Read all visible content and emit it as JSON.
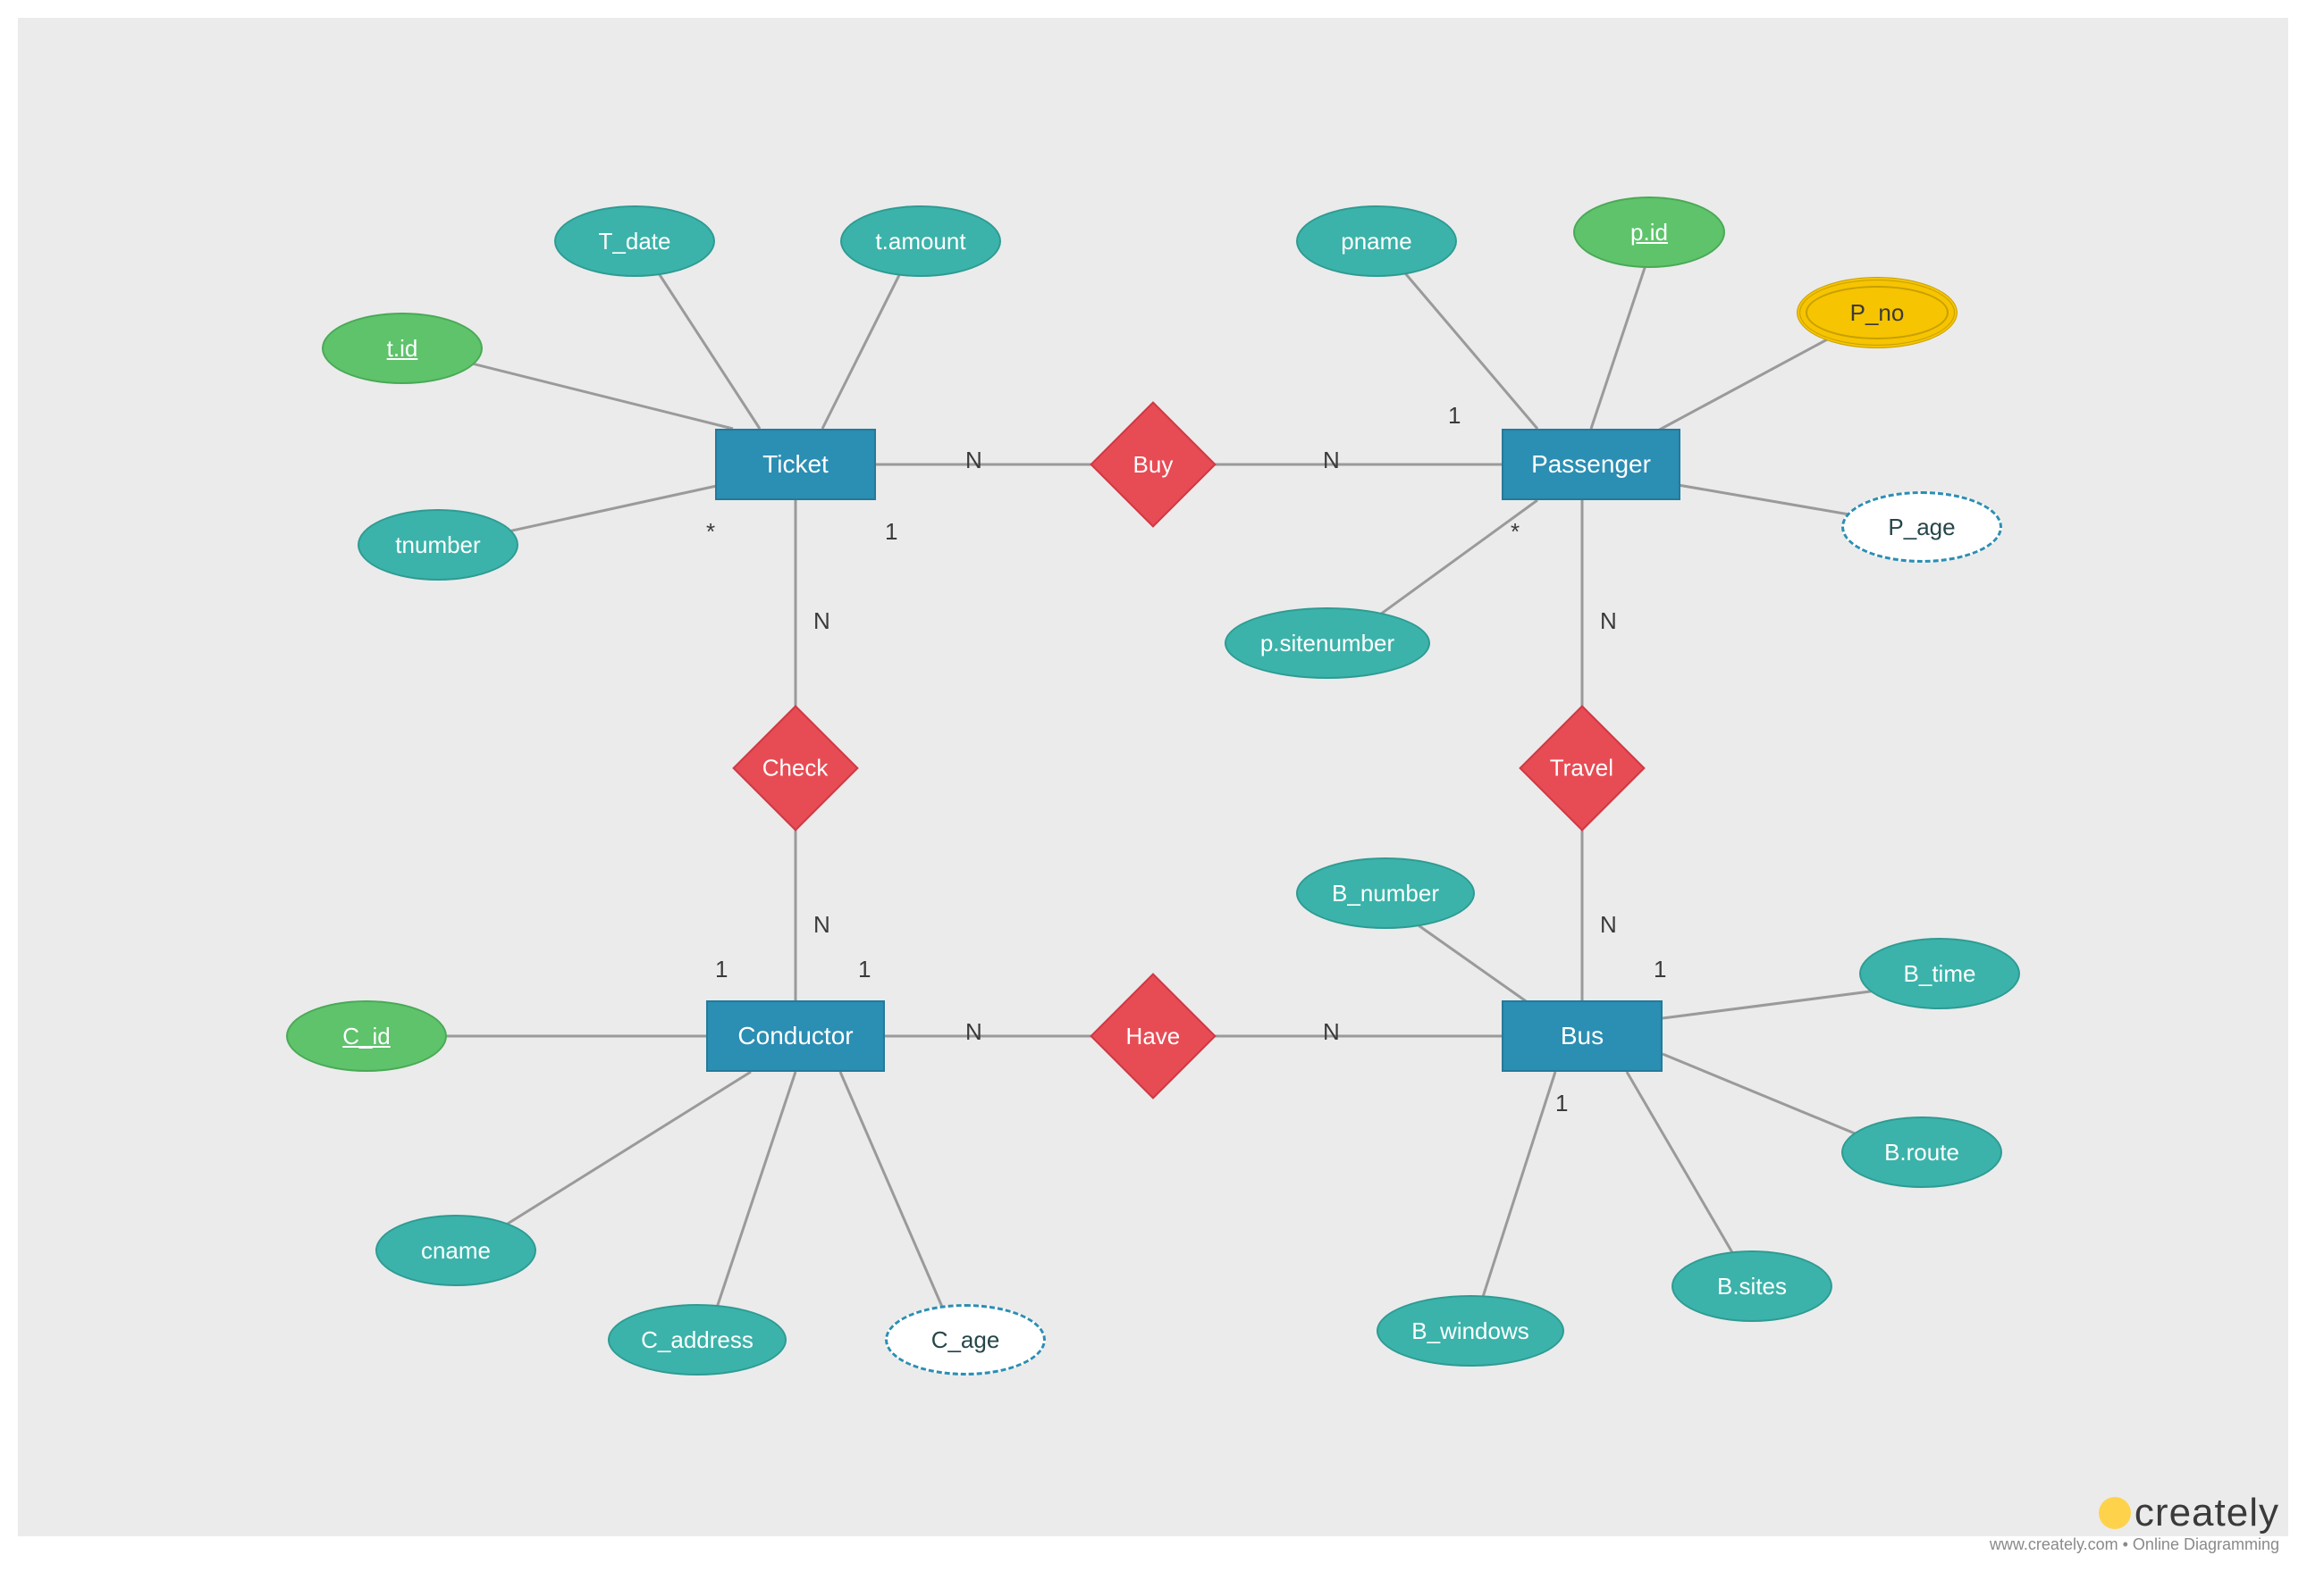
{
  "entities": {
    "ticket": {
      "label": "Ticket"
    },
    "passenger": {
      "label": "Passenger"
    },
    "conductor": {
      "label": "Conductor"
    },
    "bus": {
      "label": "Bus"
    }
  },
  "relationships": {
    "buy": {
      "label": "Buy"
    },
    "check": {
      "label": "Check"
    },
    "have": {
      "label": "Have"
    },
    "travel": {
      "label": "Travel"
    }
  },
  "attributes": {
    "t_id": {
      "label": "t.id"
    },
    "t_date": {
      "label": "T_date"
    },
    "t_amount": {
      "label": "t.amount"
    },
    "tnumber": {
      "label": "tnumber"
    },
    "pname": {
      "label": "pname"
    },
    "p_id": {
      "label": "p.id"
    },
    "p_no": {
      "label": "P_no"
    },
    "p_age": {
      "label": "P_age"
    },
    "p_sitenumber": {
      "label": "p.sitenumber"
    },
    "c_id": {
      "label": "C_id"
    },
    "cname": {
      "label": "cname"
    },
    "c_address": {
      "label": "C_address"
    },
    "c_age": {
      "label": "C_age"
    },
    "b_number": {
      "label": "B_number"
    },
    "b_time": {
      "label": "B_time"
    },
    "b_route": {
      "label": "B.route"
    },
    "b_sites": {
      "label": "B.sites"
    },
    "b_windows": {
      "label": "B_windows"
    }
  },
  "cardinalities": {
    "ticket_buy": "N",
    "buy_passenger": "N",
    "ticket_check": "N",
    "check_conductor": "N",
    "passenger_travel": "N",
    "travel_bus": "N",
    "conductor_have": "N",
    "have_bus": "N",
    "ticket_one": "1",
    "ticket_star": "*",
    "passenger_one": "1",
    "passenger_star": "*",
    "conductor_one_l": "1",
    "conductor_one_r": "1",
    "bus_one_t": "1",
    "bus_one_b": "1"
  },
  "footer": {
    "brand": "creately",
    "tagline": "www.creately.com • Online Diagramming"
  }
}
